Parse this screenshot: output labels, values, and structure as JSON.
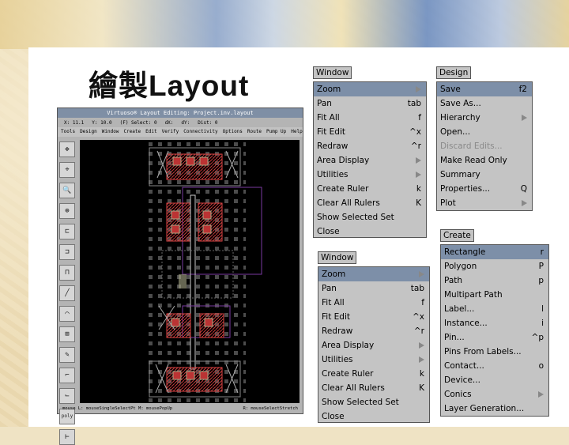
{
  "slide": {
    "title": "繪製Layout"
  },
  "virtuoso": {
    "title": "Virtuoso® Layout Editing: Project.inv.layout",
    "status": [
      "X: 11.1",
      "Y: 10.0",
      "(F) Select: 0",
      "dX:",
      "dY:",
      "Dist: 0"
    ],
    "menus": [
      "Tools",
      "Design",
      "Window",
      "Create",
      "Edit",
      "Verify",
      "Connectivity",
      "Options",
      "Route",
      "Pump Up",
      "Help"
    ],
    "tools": [
      "✥",
      "⌖",
      "🔍",
      "⊕",
      "⊏",
      "⊐",
      "⊓",
      "╱",
      "⌒",
      "⊞",
      "✎",
      "⌐",
      "⌙",
      "poly",
      "⊢"
    ],
    "footer_left": "mouse L: mouseSingleSelectPt    M: mousePopUp",
    "footer_right": "R: mouseSelectStretch"
  },
  "window_menu": {
    "title": "Window",
    "items": [
      {
        "label": "Zoom",
        "acc": "▶",
        "hl": true
      },
      {
        "label": "Pan",
        "acc": "tab"
      },
      {
        "label": "Fit All",
        "acc": "f"
      },
      {
        "label": "Fit Edit",
        "acc": "^x"
      },
      {
        "label": "Redraw",
        "acc": "^r"
      },
      {
        "label": "Area Display",
        "acc": "▶"
      },
      {
        "label": "Utilities",
        "acc": "▶"
      },
      {
        "label": "Create Ruler",
        "acc": "k"
      },
      {
        "label": "Clear All Rulers",
        "acc": "K"
      },
      {
        "label": "Show Selected Set",
        "acc": ""
      },
      {
        "label": "Close",
        "acc": ""
      }
    ]
  },
  "design_menu": {
    "title": "Design",
    "items": [
      {
        "label": "Save",
        "acc": "f2",
        "hl": true
      },
      {
        "label": "Save As...",
        "acc": ""
      },
      {
        "label": "Hierarchy",
        "acc": "▶"
      },
      {
        "label": "Open...",
        "acc": ""
      },
      {
        "label": "Discard Edits...",
        "acc": "",
        "dis": true
      },
      {
        "label": "Make Read Only",
        "acc": ""
      },
      {
        "label": "Summary",
        "acc": ""
      },
      {
        "label": "Properties...",
        "acc": "Q"
      },
      {
        "label": "Plot",
        "acc": "▶"
      }
    ]
  },
  "create_menu": {
    "title": "Create",
    "items": [
      {
        "label": "Rectangle",
        "acc": "r",
        "hl": true
      },
      {
        "label": "Polygon",
        "acc": "P"
      },
      {
        "label": "Path",
        "acc": "p"
      },
      {
        "label": "Multipart Path",
        "acc": ""
      },
      {
        "label": "Label...",
        "acc": "l"
      },
      {
        "label": "Instance...",
        "acc": "i"
      },
      {
        "label": "Pin...",
        "acc": "^p"
      },
      {
        "label": "Pins From Labels...",
        "acc": ""
      },
      {
        "label": "Contact...",
        "acc": "o"
      },
      {
        "label": "Device...",
        "acc": ""
      },
      {
        "label": "Conics",
        "acc": "▶"
      },
      {
        "label": "Layer Generation...",
        "acc": ""
      }
    ]
  },
  "window_menu2": {
    "title": "Window",
    "items": [
      {
        "label": "Zoom",
        "acc": "▶",
        "hl": true
      },
      {
        "label": "Pan",
        "acc": "tab"
      },
      {
        "label": "Fit All",
        "acc": "f"
      },
      {
        "label": "Fit Edit",
        "acc": "^x"
      },
      {
        "label": "Redraw",
        "acc": "^r"
      },
      {
        "label": "Area Display",
        "acc": "▶"
      },
      {
        "label": "Utilities",
        "acc": "▶"
      },
      {
        "label": "Create Ruler",
        "acc": "k"
      },
      {
        "label": "Clear All Rulers",
        "acc": "K"
      },
      {
        "label": "Show Selected Set",
        "acc": ""
      },
      {
        "label": "Close",
        "acc": ""
      }
    ]
  }
}
